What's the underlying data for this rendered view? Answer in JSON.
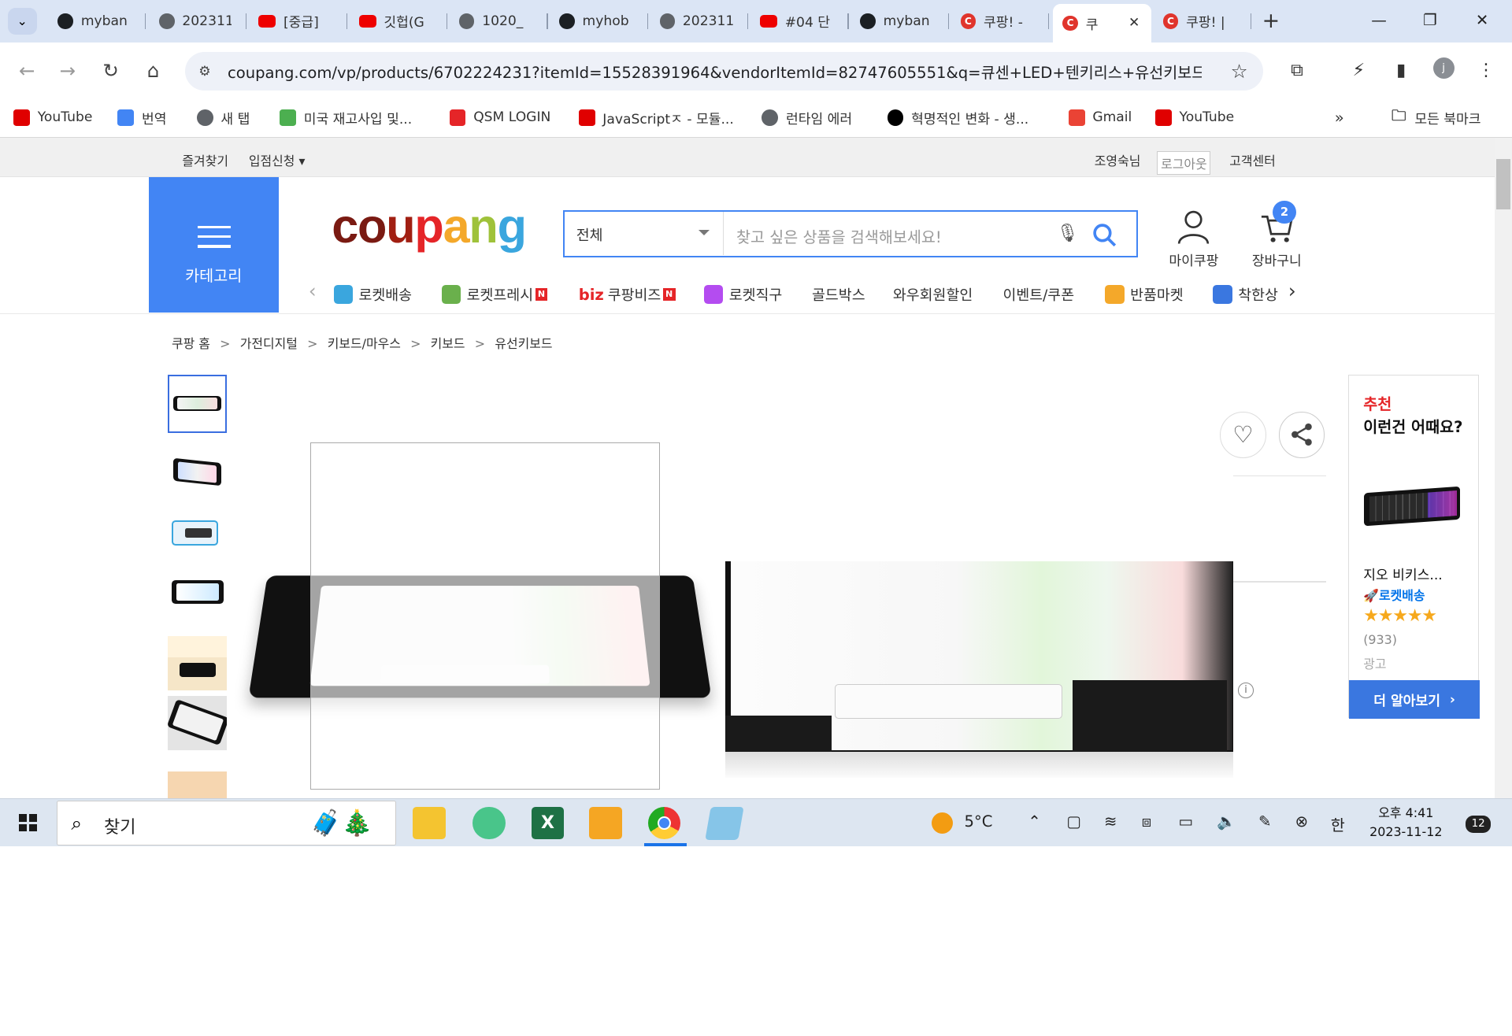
{
  "browser": {
    "tabs": [
      {
        "title": "myban",
        "icon": "github-icon",
        "active": false
      },
      {
        "title": "202311",
        "icon": "globe-icon",
        "active": false
      },
      {
        "title": "[중급]",
        "icon": "youtube-icon",
        "active": false
      },
      {
        "title": "깃헙(G",
        "icon": "youtube-icon",
        "active": false
      },
      {
        "title": "1020_",
        "icon": "globe-icon",
        "active": false
      },
      {
        "title": "myhob",
        "icon": "github-icon",
        "active": false
      },
      {
        "title": "202311",
        "icon": "globe-icon",
        "active": false
      },
      {
        "title": "#04 단",
        "icon": "youtube-icon",
        "active": false
      },
      {
        "title": "myban",
        "icon": "github-icon",
        "active": false
      },
      {
        "title": "쿠팡! -",
        "icon": "coupang-icon",
        "active": false
      },
      {
        "title": "쿠",
        "icon": "coupang-icon",
        "active": true
      },
      {
        "title": "쿠팡! |",
        "icon": "coupang-icon",
        "active": false
      }
    ],
    "url": "coupang.com/vp/products/6702224231?itemId=15528391964&vendorItemId=82747605551&q=큐센+LED+텐키리스+유선키보드...",
    "profile_initial": "j",
    "bookmarks": [
      {
        "label": "YouTube",
        "icon": "youtube-icon",
        "color": "#e00000"
      },
      {
        "label": "번역",
        "icon": "translate-icon",
        "color": "#4285f4"
      },
      {
        "label": "새 탭",
        "icon": "globe-icon",
        "color": "#5f6368"
      },
      {
        "label": "미국 재고사입 및...",
        "icon": "leaf-icon",
        "color": "#4caf50"
      },
      {
        "label": "QSM LOGIN",
        "icon": "qsm-icon",
        "color": "#e52528"
      },
      {
        "label": "JavaScriptㅈ - 모듈...",
        "icon": "youtube-icon",
        "color": "#e00000"
      },
      {
        "label": "런타임 에러",
        "icon": "globe-icon",
        "color": "#5f6368"
      },
      {
        "label": "혁명적인 변화 - 생...",
        "icon": "circle-icon",
        "color": "#000000"
      },
      {
        "label": "Gmail",
        "icon": "gmail-icon",
        "color": "#ea4335"
      },
      {
        "label": "YouTube",
        "icon": "youtube-icon",
        "color": "#e00000"
      }
    ],
    "all_bookmarks": "모든 북마크"
  },
  "site": {
    "topbar": {
      "favorites": "즐겨찾기",
      "join": "입점신청",
      "user": "조영숙님",
      "logout": "로그아웃",
      "support": "고객센터"
    },
    "category_label": "카테고리",
    "logo": "coupang",
    "search": {
      "category": "전체",
      "placeholder": "찾고 싶은 상품을 검색해보세요!"
    },
    "my_coupang": "마이쿠팡",
    "cart": "장바구니",
    "cart_count": "2",
    "nav": [
      {
        "label": "로켓배송",
        "badge": ""
      },
      {
        "label": "로켓프레시",
        "badge": "N"
      },
      {
        "label": "쿠팡비즈",
        "badge": "N"
      },
      {
        "label": "로켓직구",
        "badge": ""
      },
      {
        "label": "골드박스",
        "badge": ""
      },
      {
        "label": "와우회원할인",
        "badge": ""
      },
      {
        "label": "이벤트/쿠폰",
        "badge": ""
      },
      {
        "label": "반품마켓",
        "badge": ""
      },
      {
        "label": "착한상",
        "badge": ""
      }
    ],
    "biz_prefix": "biz",
    "breadcrumb": [
      "쿠팡 홈",
      "가전디지털",
      "키보드/마우스",
      "키보드",
      "유선키보드"
    ],
    "breadcrumb_sep": ">",
    "recommend": {
      "title1": "추천",
      "title2": "이런건 어때요?",
      "product": "지오 비키스...",
      "rocket": "로켓배송",
      "rating": 4.5,
      "reviews": "(933)",
      "ad": "광고",
      "more": "더 알아보기"
    }
  },
  "taskbar": {
    "search": "찾기",
    "weather": "5°C",
    "ime": "한",
    "time": "오후 4:41",
    "date": "2023-11-12",
    "notifications": "12"
  }
}
